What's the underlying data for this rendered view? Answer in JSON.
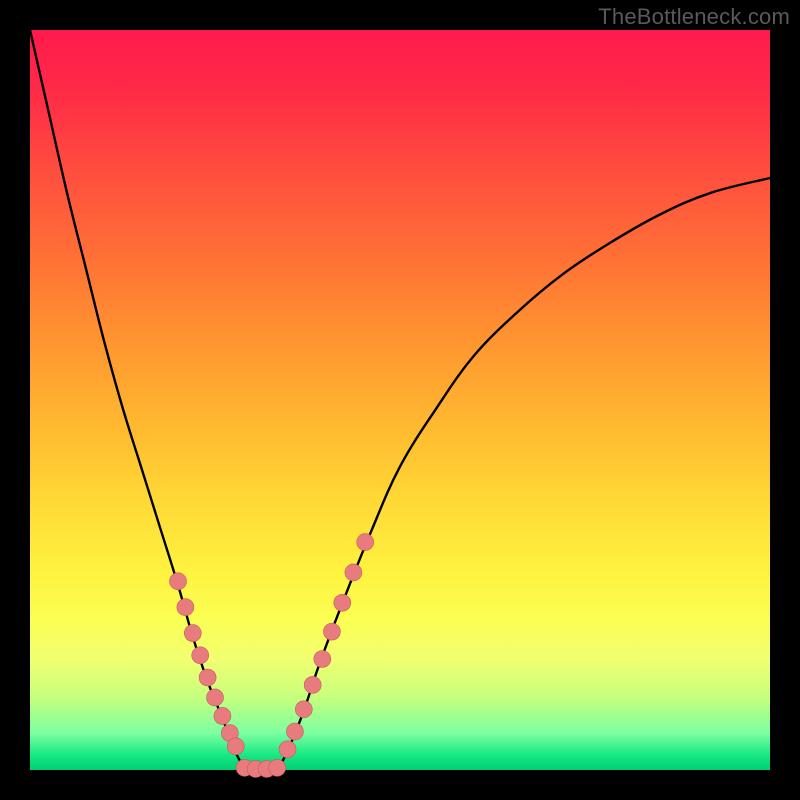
{
  "watermark": "TheBottleneck.com",
  "colors": {
    "frame": "#000000",
    "curve": "#000000",
    "marker_fill": "#e77b7e",
    "marker_stroke": "#c9595f"
  },
  "chart_data": {
    "type": "line",
    "title": "",
    "xlabel": "",
    "ylabel": "",
    "xlim": [
      0,
      100
    ],
    "ylim": [
      0,
      100
    ],
    "left_curve": {
      "x": [
        0,
        2.5,
        5,
        7.5,
        10,
        12.5,
        15,
        17.5,
        20,
        22.0,
        24.0,
        26.0,
        27.5,
        28.5,
        29.0
      ],
      "y": [
        100,
        89,
        78,
        68,
        58,
        49,
        41,
        33,
        25,
        18,
        12,
        7,
        3,
        1,
        0
      ]
    },
    "right_curve": {
      "x": [
        33.5,
        35,
        37,
        39,
        42,
        46,
        50,
        55,
        60,
        66,
        72,
        78,
        85,
        92,
        100
      ],
      "y": [
        0,
        3,
        8,
        14,
        22,
        32,
        41,
        49,
        56,
        62,
        67,
        71,
        75,
        78,
        80
      ]
    },
    "flat_bottom": {
      "x": [
        29.0,
        33.5
      ],
      "y": [
        0,
        0
      ]
    },
    "markers_left": {
      "x": [
        20.0,
        21.0,
        22.0,
        23.0,
        24.0,
        25.0,
        26.0,
        27.0,
        27.8
      ],
      "y": [
        25.5,
        22.0,
        18.5,
        15.5,
        12.5,
        9.8,
        7.3,
        5.0,
        3.2
      ]
    },
    "markers_right": {
      "x": [
        34.8,
        35.8,
        37.0,
        38.2,
        39.5,
        40.8,
        42.2,
        43.7,
        45.3
      ],
      "y": [
        2.8,
        5.2,
        8.2,
        11.5,
        15.0,
        18.7,
        22.6,
        26.7,
        30.8
      ]
    },
    "markers_bottom": {
      "x": [
        29.0,
        30.5,
        32.0,
        33.4
      ],
      "y": [
        0.3,
        0.15,
        0.15,
        0.3
      ]
    }
  }
}
